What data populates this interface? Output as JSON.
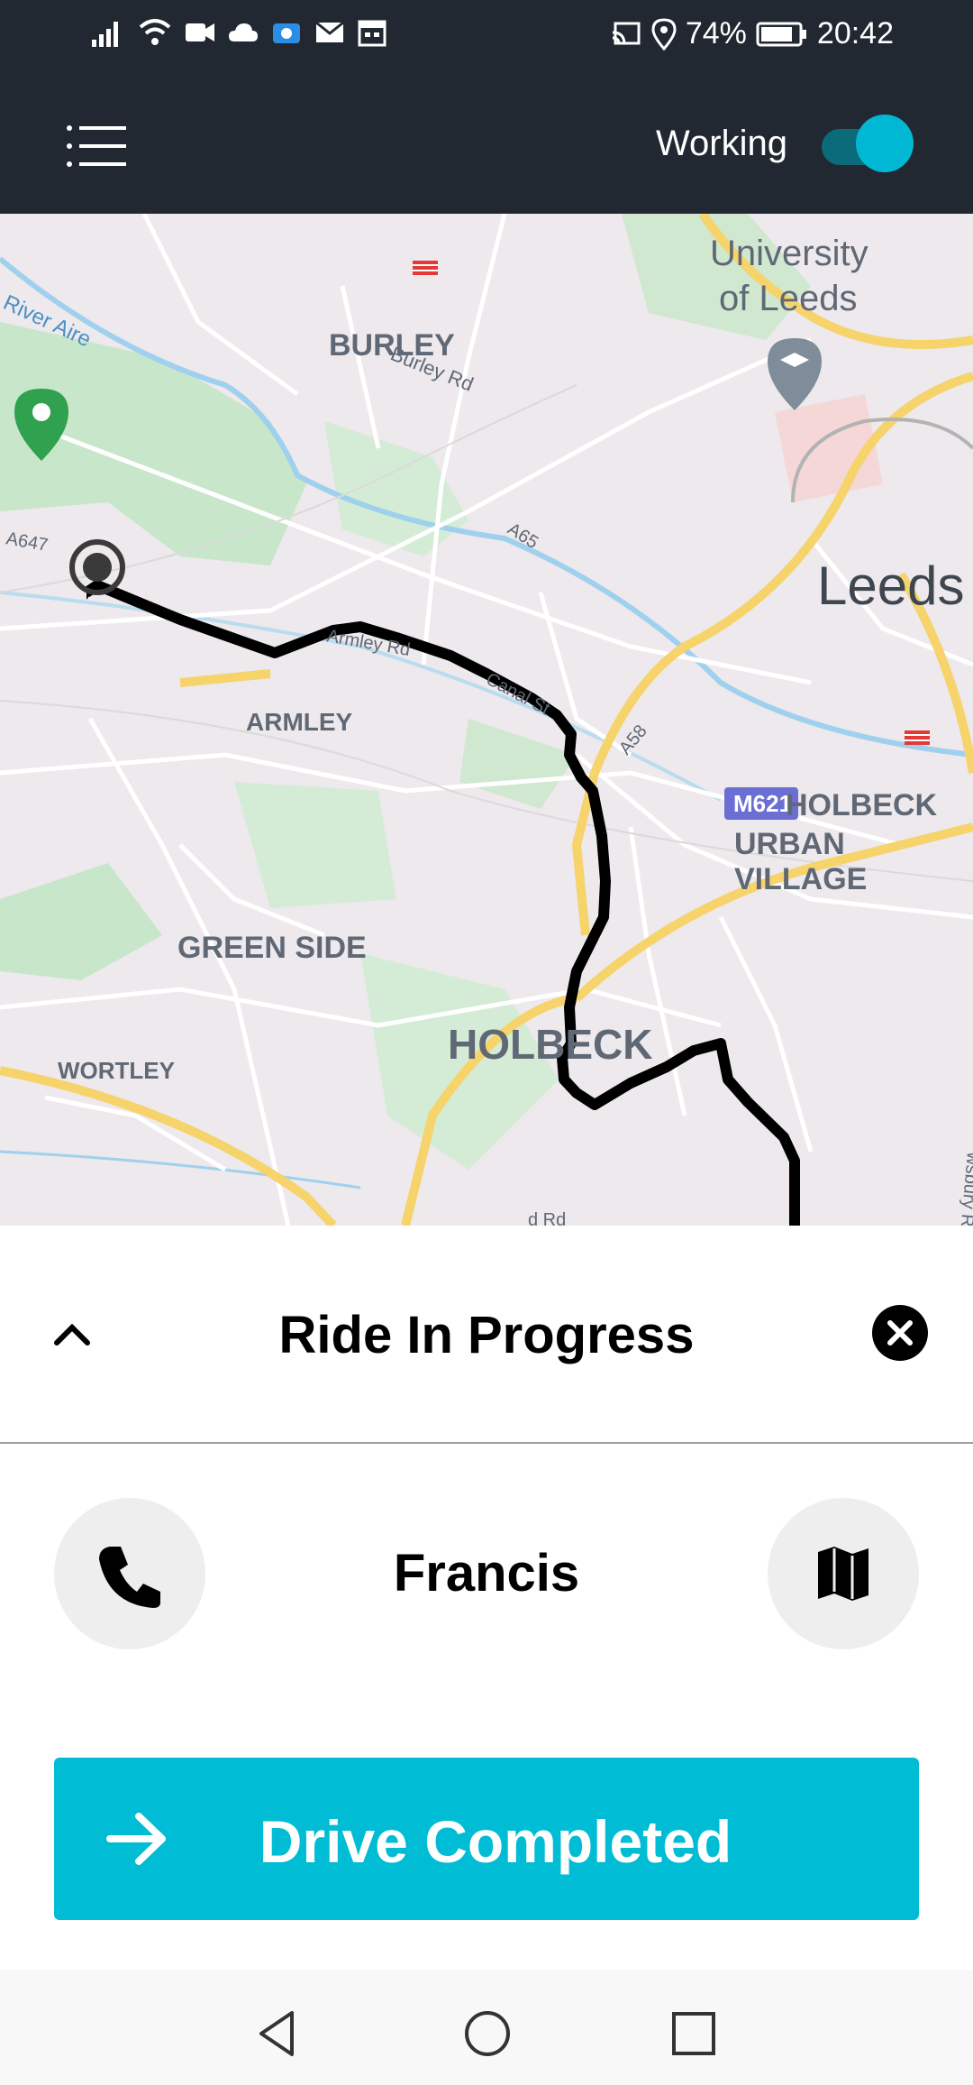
{
  "status_bar": {
    "battery": "74%",
    "time": "20:42",
    "icons": [
      "signal-icon",
      "wifi-icon",
      "video-icon",
      "cloud-icon",
      "notification-icon",
      "mail-icon",
      "calendar-icon",
      "cast-icon",
      "location-icon",
      "battery-icon"
    ]
  },
  "app_bar": {
    "menu_icon": "menu-icon",
    "working_label": "Working",
    "working_on": true
  },
  "map": {
    "labels": {
      "river_aire": "River Aire",
      "burley": "BURLEY",
      "burley_rd": "Burley Rd",
      "university": "University",
      "of_leeds": "of Leeds",
      "leeds": "Leeds",
      "a647": "A647",
      "a65": "A65",
      "armley_rd": "Armley Rd",
      "canal_st": "Canal St",
      "a58": "A58",
      "armley": "ARMLEY",
      "holbeck_urban_1": "HOLBECK",
      "holbeck_urban_2": "URBAN VILLAGE",
      "green_side": "GREEN SIDE",
      "holbeck": "HOLBECK",
      "wortley": "WORTLEY",
      "m621": "M621",
      "rd": "d Rd",
      "wsbury": "wsbury Rd"
    }
  },
  "sheet": {
    "title": "Ride In Progress",
    "passenger_name": "Francis",
    "primary_action": "Drive Completed"
  },
  "colors": {
    "app_bar": "#222831",
    "accent": "#00bcd4",
    "route": "#000000",
    "map_bg": "#ede9ec",
    "park": "#c8e6c9",
    "road_major": "#f6d36b",
    "water": "#9fd1ee"
  }
}
